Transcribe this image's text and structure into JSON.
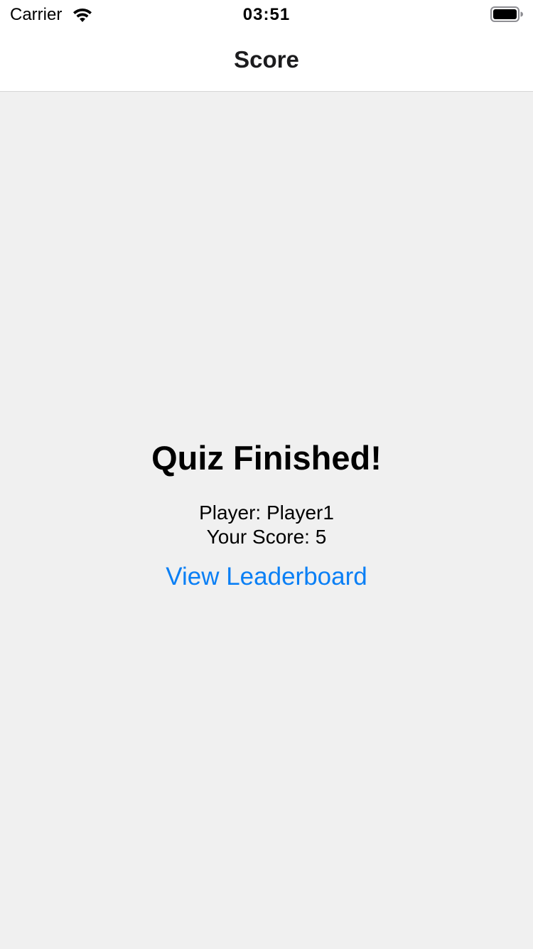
{
  "status_bar": {
    "carrier": "Carrier",
    "time": "03:51",
    "icons": [
      "wifi-icon",
      "battery-icon"
    ]
  },
  "nav": {
    "title": "Score"
  },
  "result": {
    "heading": "Quiz Finished!",
    "player_line": "Player: Player1",
    "score_line": "Your Score: 5",
    "leaderboard_link": "View Leaderboard"
  },
  "colors": {
    "link": "#0a7ff5",
    "background": "#f0f0f0",
    "bar_background": "#ffffff"
  }
}
